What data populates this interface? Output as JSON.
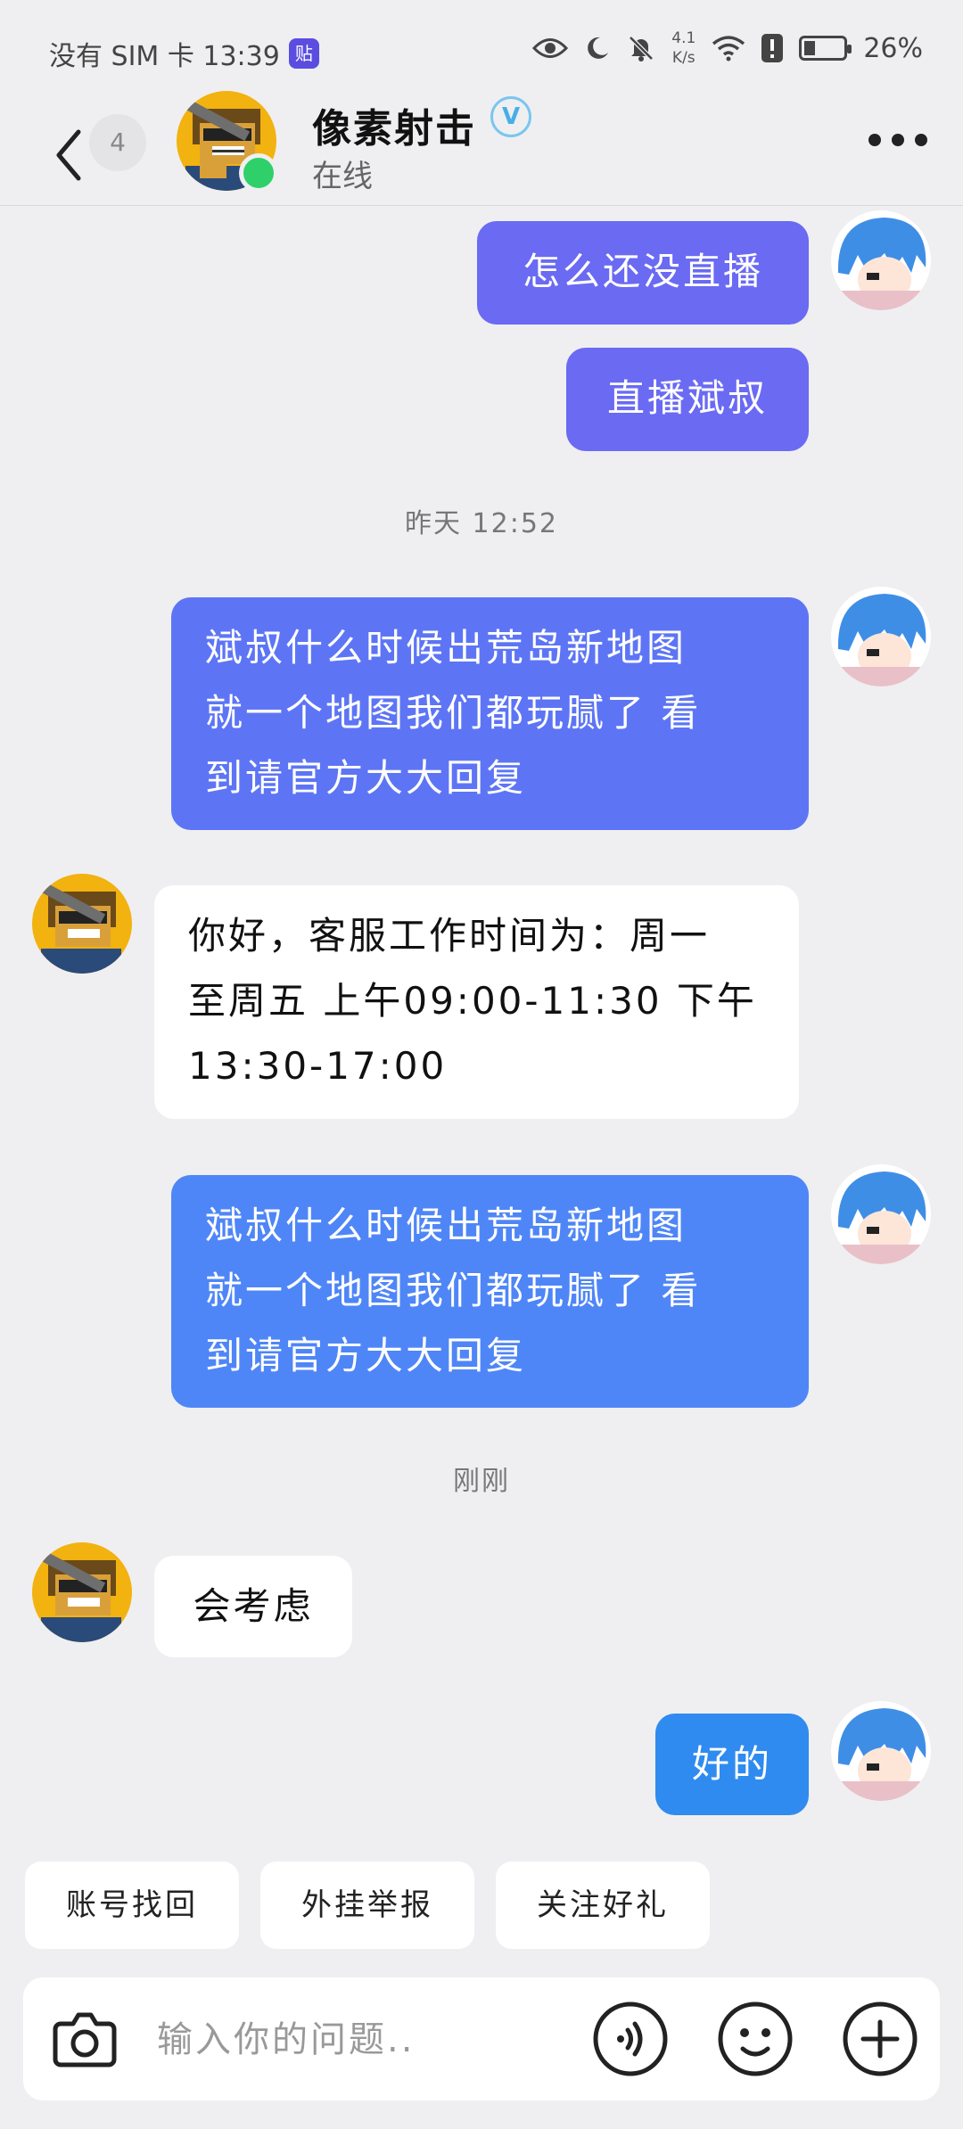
{
  "status_bar": {
    "carrier": "没有 SIM 卡 13:39",
    "app_badge": "贴",
    "speed_top": "4.1",
    "speed_bottom": "K/s",
    "battery": "26%"
  },
  "header": {
    "unread_count": "4",
    "name": "像素射击",
    "verified": "V",
    "status": "在线"
  },
  "messages": [
    {
      "from": "me",
      "text": "怎么还没直播"
    },
    {
      "from": "me",
      "text": "直播斌叔"
    },
    {
      "time": "昨天 12:52"
    },
    {
      "from": "me",
      "lines": [
        "斌叔什么时候出荒岛新地图",
        "就一个地图我们都玩腻了 看",
        "到请官方大大回复"
      ]
    },
    {
      "from": "them",
      "lines": [
        "你好，客服工作时间为：周一",
        "至周五 上午09:00-11:30 下午",
        "13:30-17:00"
      ]
    },
    {
      "from": "me",
      "lines": [
        "斌叔什么时候出荒岛新地图",
        "就一个地图我们都玩腻了 看",
        "到请官方大大回复"
      ]
    },
    {
      "time": "刚刚"
    },
    {
      "from": "them",
      "text": "会考虑"
    },
    {
      "from": "me",
      "text": "好的"
    }
  ],
  "quick_replies": [
    "账号找回",
    "外挂举报",
    "关注好礼"
  ],
  "input": {
    "placeholder": "输入你的问题.."
  },
  "colors": {
    "bubble_violet": "#6a6af3",
    "bubble_blue": "#4f86f7",
    "online": "#2fd06a"
  }
}
